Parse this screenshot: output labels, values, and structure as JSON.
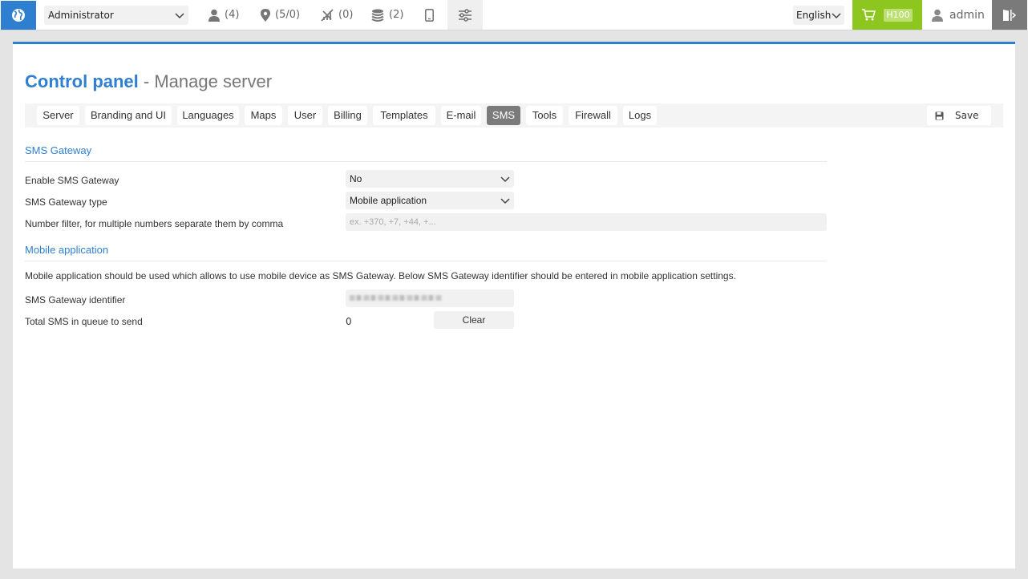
{
  "topbar": {
    "role": "Administrator",
    "stats": {
      "users": "(4)",
      "places": "(5/0)",
      "no_signal": "(0)",
      "database": "(2)"
    },
    "language": "English",
    "cart_badge": "H100",
    "username": "admin"
  },
  "page": {
    "title_main": "Control panel",
    "title_sub": " - Manage server"
  },
  "tabs": [
    "Server",
    "Branding and UI",
    "Languages",
    "Maps",
    "User",
    "Billing",
    "Templates",
    "E-mail",
    "SMS",
    "Tools",
    "Firewall",
    "Logs"
  ],
  "active_tab": "SMS",
  "save_label": "Save",
  "sms_gateway": {
    "section_title": "SMS Gateway",
    "enable_label": "Enable SMS Gateway",
    "enable_value": "No",
    "type_label": "SMS Gateway type",
    "type_value": "Mobile application",
    "filter_label": "Number filter, for multiple numbers separate them by comma",
    "filter_placeholder": "ex. +370, +7, +44, +..."
  },
  "mobile_app": {
    "section_title": "Mobile application",
    "description": "Mobile application should be used which allows to use mobile device as SMS Gateway. Below SMS Gateway identifier should be entered in mobile application settings.",
    "identifier_label": "SMS Gateway identifier",
    "queue_label": "Total SMS in queue to send",
    "queue_value": "0",
    "clear_label": "Clear"
  },
  "colors": {
    "accent": "#2f7fd0",
    "cart": "#8cc61e",
    "active_tab": "#7b7b7b"
  },
  "icons": [
    "globe-icon",
    "chevron-down-icon",
    "user-icon",
    "map-pin-icon",
    "signal-off-icon",
    "database-icon",
    "phone-icon",
    "sliders-icon",
    "cart-icon",
    "logout-icon",
    "floppy-icon"
  ]
}
